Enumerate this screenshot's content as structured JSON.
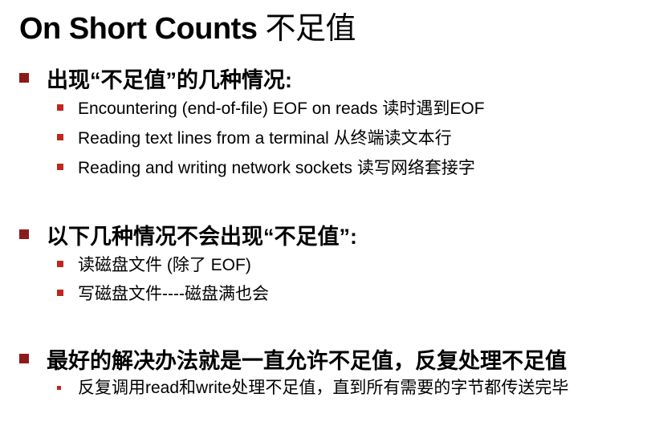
{
  "title": {
    "latin": "On Short Counts ",
    "cjk": "不足值"
  },
  "sections": [
    {
      "heading": "出现“不足值”的几种情况:",
      "items": [
        "Encountering (end-of-file) EOF on reads 读时遇到EOF",
        "Reading text lines from a terminal 从终端读文本行",
        "Reading and writing network sockets 读写网络套接字"
      ]
    },
    {
      "heading": "以下几种情况不会出现“不足值”:",
      "items": [
        "读磁盘文件 (除了 EOF)",
        "写磁盘文件----磁盘满也会"
      ]
    },
    {
      "heading": "最好的解决办法就是一直允许不足值，反复处理不足值",
      "items": [
        "反复调用read和write处理不足值，直到所有需要的字节都传送完毕"
      ]
    }
  ],
  "colors": {
    "bullet_level1": "#8b1a1a",
    "bullet_level2": "#c0271f",
    "text": "#000000"
  }
}
